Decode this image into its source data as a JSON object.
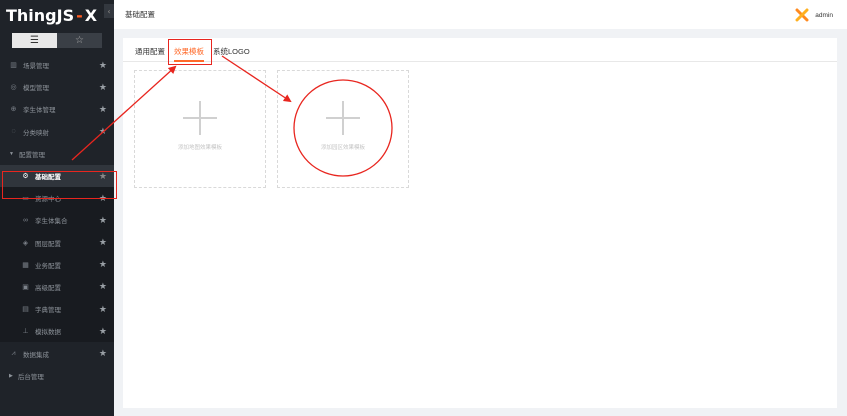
{
  "app": {
    "logo_main": "ThingJS",
    "logo_sep": "-",
    "logo_x": "X"
  },
  "sidebar": {
    "collapse_glyph": "‹",
    "view_list_glyph": "☰",
    "view_star_glyph": "☆",
    "items": [
      {
        "label": "场景管理",
        "icon": "▥"
      },
      {
        "label": "模型管理",
        "icon": "◎"
      },
      {
        "label": "孪生体管理",
        "icon": "⊕"
      },
      {
        "label": "分类映射",
        "icon": "◌"
      },
      {
        "label": "配置管理",
        "caret": "▼"
      },
      {
        "label": "基础配置",
        "icon": "⚙"
      },
      {
        "label": "资源中心",
        "icon": "▭"
      },
      {
        "label": "孪生体集合",
        "icon": "∞"
      },
      {
        "label": "图层配置",
        "icon": "◈"
      },
      {
        "label": "业务配置",
        "icon": "▦"
      },
      {
        "label": "高级配置",
        "icon": "▣"
      },
      {
        "label": "字典管理",
        "icon": "▤"
      },
      {
        "label": "模拟数据",
        "icon": "⊥"
      },
      {
        "label": "数据集成",
        "icon": "⩘"
      },
      {
        "label": "后台管理",
        "caret": "▶"
      }
    ],
    "star_glyph": "★"
  },
  "topbar": {
    "title": "基础配置",
    "user": "admin"
  },
  "tabs": [
    {
      "label": "通用配置"
    },
    {
      "label": "效果模板"
    },
    {
      "label": "系统LOGO"
    }
  ],
  "cards": [
    {
      "label": "添加地图效果模板"
    },
    {
      "label": "添加园区效果模板"
    }
  ],
  "colors": {
    "accent": "#ff6a2a",
    "annotation": "#e8261f",
    "sidebar_bg": "#1f2329"
  }
}
